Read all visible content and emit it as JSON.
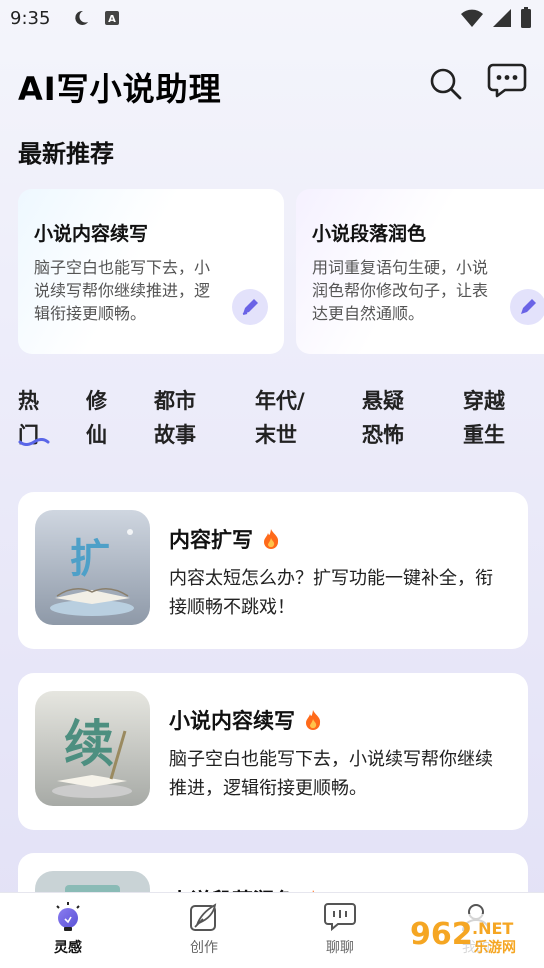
{
  "status_bar": {
    "time": "9:35"
  },
  "header": {
    "title": "AI写小说助理"
  },
  "section": {
    "title": "最新推荐"
  },
  "recommendations": [
    {
      "title": "小说内容续写",
      "desc": "脑子空白也能写下去，小说续写帮你继续推进，逻辑衔接更顺畅。"
    },
    {
      "title": "小说段落润色",
      "desc": "用词重复语句生硬，小说润色帮你修改句子，让表达更自然通顺。"
    }
  ],
  "categories": [
    {
      "l1": "热",
      "l2": "门"
    },
    {
      "l1": "修",
      "l2": "仙"
    },
    {
      "l1": "都市",
      "l2": "故事"
    },
    {
      "l1": "年代/",
      "l2": "末世"
    },
    {
      "l1": "悬疑",
      "l2": "恐怖"
    },
    {
      "l1": "穿越",
      "l2": "重生"
    }
  ],
  "features": [
    {
      "title": "内容扩写",
      "thumb_char": "扩",
      "desc": "内容太短怎么办？扩写功能一键补全，衔接顺畅不跳戏！"
    },
    {
      "title": "小说内容续写",
      "thumb_char": "续",
      "desc": "脑子空白也能写下去，小说续写帮你继续推进，逻辑衔接更顺畅。"
    },
    {
      "title": "小说段落润色",
      "thumb_char": "",
      "desc": ""
    }
  ],
  "bottom_nav": [
    {
      "label": "灵感",
      "icon": "bulb-icon",
      "active": true
    },
    {
      "label": "创作",
      "icon": "quill-icon",
      "active": false
    },
    {
      "label": "聊聊",
      "icon": "chat-icon",
      "active": false
    },
    {
      "label": "我的",
      "icon": "profile-icon",
      "active": false
    }
  ],
  "watermark": {
    "text": "962.NET",
    "sub": "乐游网"
  },
  "colors": {
    "accent": "#6a63e6",
    "fire": "#ff6a1a",
    "active_tab_underline": "#5a66e8"
  }
}
